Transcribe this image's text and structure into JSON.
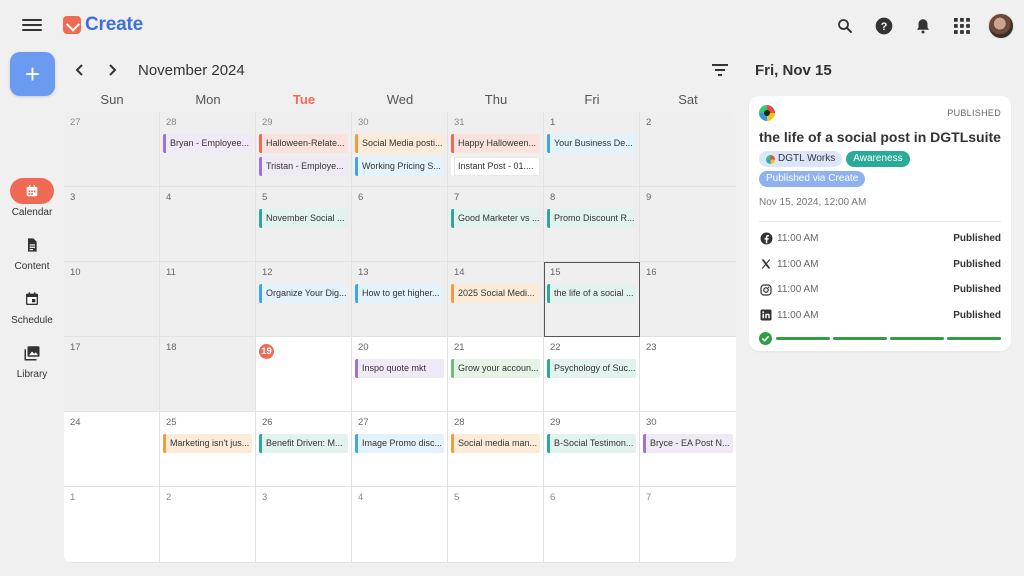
{
  "app": {
    "logo_text": "Create"
  },
  "top_icons": [
    "search-icon",
    "help-icon",
    "bell-icon",
    "apps-grid-icon",
    "avatar"
  ],
  "new_button": {
    "label": "+"
  },
  "rail": [
    {
      "label": "Calendar",
      "icon": "calendar-icon",
      "active": true
    },
    {
      "label": "Content",
      "icon": "document-icon",
      "active": false
    },
    {
      "label": "Schedule",
      "icon": "schedule-icon",
      "active": false
    },
    {
      "label": "Library",
      "icon": "library-icon",
      "active": false
    }
  ],
  "calendar": {
    "month_label": "November 2024",
    "weekdays": [
      "Sun",
      "Mon",
      "Tue",
      "Wed",
      "Thu",
      "Fri",
      "Sat"
    ],
    "today_weekday_index": 2,
    "weeks": [
      [
        {
          "day": "27",
          "past": true,
          "other": true,
          "events": []
        },
        {
          "day": "28",
          "past": true,
          "other": true,
          "events": [
            {
              "label": "Bryan - Employee...",
              "color": "purple"
            }
          ]
        },
        {
          "day": "29",
          "past": true,
          "other": true,
          "events": [
            {
              "label": "Halloween-Relate...",
              "color": "red"
            },
            {
              "label": "Tristan - Employe...",
              "color": "purple"
            }
          ]
        },
        {
          "day": "30",
          "past": true,
          "other": true,
          "events": [
            {
              "label": "Social Media posti...",
              "color": "orange"
            },
            {
              "label": "Working Pricing S...",
              "color": "blue"
            }
          ]
        },
        {
          "day": "31",
          "past": true,
          "other": true,
          "events": [
            {
              "label": "Happy Halloween...",
              "color": "red"
            },
            {
              "label": "Instant Post - 01....",
              "color": "plain"
            }
          ]
        },
        {
          "day": "1",
          "past": true,
          "events": [
            {
              "label": "Your Business De...",
              "color": "blue"
            }
          ]
        },
        {
          "day": "2",
          "past": true,
          "events": []
        }
      ],
      [
        {
          "day": "3",
          "past": true,
          "events": []
        },
        {
          "day": "4",
          "past": true,
          "events": []
        },
        {
          "day": "5",
          "past": true,
          "events": [
            {
              "label": "November Social ...",
              "color": "teal"
            }
          ]
        },
        {
          "day": "6",
          "past": true,
          "events": []
        },
        {
          "day": "7",
          "past": true,
          "events": [
            {
              "label": "Good Marketer vs ...",
              "color": "teal"
            }
          ]
        },
        {
          "day": "8",
          "past": true,
          "events": [
            {
              "label": "Promo Discount R...",
              "color": "teal"
            }
          ]
        },
        {
          "day": "9",
          "past": true,
          "events": []
        }
      ],
      [
        {
          "day": "10",
          "past": true,
          "events": []
        },
        {
          "day": "11",
          "past": true,
          "events": []
        },
        {
          "day": "12",
          "past": true,
          "events": [
            {
              "label": "Organize Your Dig...",
              "color": "blue"
            }
          ]
        },
        {
          "day": "13",
          "past": true,
          "events": [
            {
              "label": "How to get higher...",
              "color": "blue"
            }
          ]
        },
        {
          "day": "14",
          "past": true,
          "events": [
            {
              "label": "2025 Social Medi...",
              "color": "orange"
            }
          ]
        },
        {
          "day": "15",
          "past": true,
          "selected": true,
          "events": [
            {
              "label": "the life of a social ...",
              "color": "teal"
            }
          ]
        },
        {
          "day": "16",
          "past": true,
          "events": []
        }
      ],
      [
        {
          "day": "17",
          "past": true,
          "events": []
        },
        {
          "day": "18",
          "past": true,
          "events": []
        },
        {
          "day": "19",
          "today": true,
          "events": []
        },
        {
          "day": "20",
          "events": [
            {
              "label": "Inspo quote mkt",
              "color": "purple"
            }
          ]
        },
        {
          "day": "21",
          "events": [
            {
              "label": "Grow your accoun...",
              "color": "green"
            }
          ]
        },
        {
          "day": "22",
          "events": [
            {
              "label": "Psychology of Suc...",
              "color": "teal"
            }
          ]
        },
        {
          "day": "23",
          "events": []
        }
      ],
      [
        {
          "day": "24",
          "events": []
        },
        {
          "day": "25",
          "events": [
            {
              "label": "Marketing isn't jus...",
              "color": "orange"
            }
          ]
        },
        {
          "day": "26",
          "events": [
            {
              "label": "Benefit Driven: M...",
              "color": "teal"
            }
          ]
        },
        {
          "day": "27",
          "events": [
            {
              "label": "Image Promo disc...",
              "color": "blue"
            }
          ]
        },
        {
          "day": "28",
          "events": [
            {
              "label": "Social media man...",
              "color": "orange"
            }
          ]
        },
        {
          "day": "29",
          "events": [
            {
              "label": "B-Social Testimon...",
              "color": "teal"
            }
          ]
        },
        {
          "day": "30",
          "events": [
            {
              "label": "Bryce - EA Post N...",
              "color": "purple"
            }
          ]
        }
      ],
      [
        {
          "day": "1",
          "other": true,
          "events": []
        },
        {
          "day": "2",
          "other": true,
          "events": []
        },
        {
          "day": "3",
          "other": true,
          "events": []
        },
        {
          "day": "4",
          "other": true,
          "events": []
        },
        {
          "day": "5",
          "other": true,
          "events": []
        },
        {
          "day": "6",
          "other": true,
          "events": []
        },
        {
          "day": "7",
          "other": true,
          "events": []
        }
      ]
    ]
  },
  "side": {
    "date_label": "Fri, Nov 15",
    "card": {
      "status": "PUBLISHED",
      "title": "the life of a social post in DGTLsuite",
      "tags": [
        {
          "label": "DGTL Works",
          "style": "blue-light",
          "dot": true
        },
        {
          "label": "Awareness",
          "style": "teal",
          "dot": false
        },
        {
          "label": "Published via Create",
          "style": "blue",
          "dot": false
        }
      ],
      "scheduled": "Nov 15, 2024, 12:00 AM",
      "platforms": [
        {
          "icon": "facebook-icon",
          "time": "11:00 AM",
          "status": "Published"
        },
        {
          "icon": "x-icon",
          "time": "11:00 AM",
          "status": "Published"
        },
        {
          "icon": "instagram-icon",
          "time": "11:00 AM",
          "status": "Published"
        },
        {
          "icon": "linkedin-icon",
          "time": "11:00 AM",
          "status": "Published"
        }
      ],
      "progress_segments": 4,
      "progress_complete": 4
    }
  },
  "colors": {
    "accent": "#ef6a55",
    "brand_blue": "#3d6fdc",
    "new_button": "#6a9bf0",
    "success": "#2ea043"
  }
}
